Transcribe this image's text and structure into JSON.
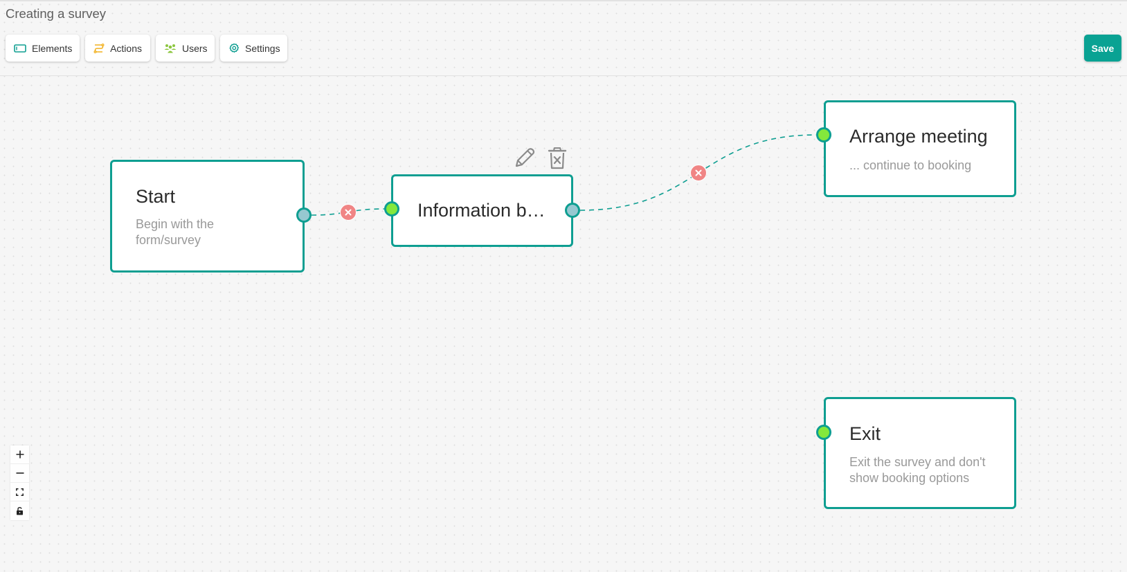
{
  "page": {
    "title": "Creating a survey"
  },
  "toolbar": {
    "buttons": [
      {
        "label": "Elements",
        "icon": "rectangle-icon",
        "color": "#0e9e91"
      },
      {
        "label": "Actions",
        "icon": "route-icon",
        "color": "#f2b01e"
      },
      {
        "label": "Users",
        "icon": "users-icon",
        "color": "#8cc63f"
      },
      {
        "label": "Settings",
        "icon": "gear-icon",
        "color": "#0e9e91"
      }
    ],
    "save_label": "Save"
  },
  "colors": {
    "accent": "#0e9e91",
    "save": "#0aa293",
    "target_handle": "#84e83c",
    "source_handle": "#96c8d0",
    "edge_delete": "#f08585"
  },
  "flow": {
    "nodes": [
      {
        "id": "start",
        "title": "Start",
        "description": "Begin with the form/survey"
      },
      {
        "id": "info",
        "title": "Information b…",
        "description": ""
      },
      {
        "id": "meeting",
        "title": "Arrange meeting",
        "description": "... continue to booking"
      },
      {
        "id": "exit",
        "title": "Exit",
        "description": "Exit the survey and don't show booking options"
      }
    ],
    "edges": [
      {
        "source": "start",
        "target": "info",
        "style": "dashed"
      },
      {
        "source": "info",
        "target": "meeting",
        "style": "dashed"
      }
    ],
    "selected_node_tools": [
      "edit-icon",
      "delete-icon"
    ]
  },
  "controls": [
    "zoom-in",
    "zoom-out",
    "fit-view",
    "lock"
  ]
}
